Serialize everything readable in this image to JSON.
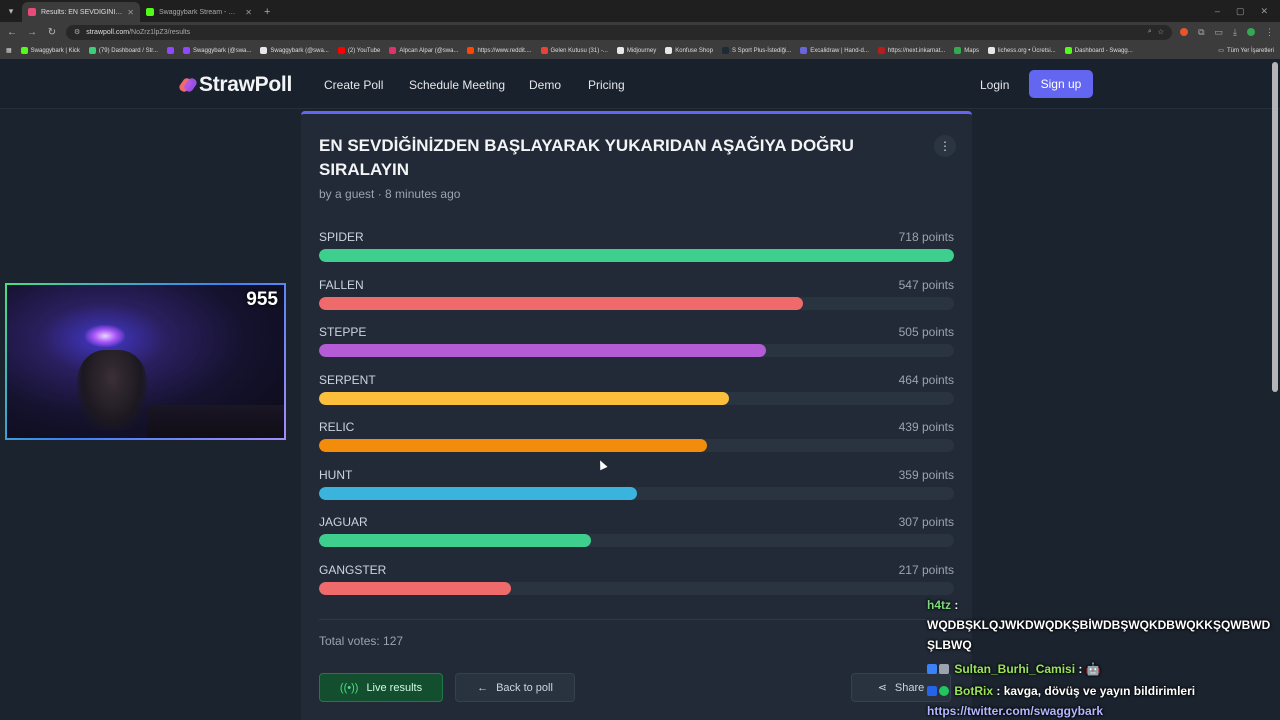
{
  "browser": {
    "tabs": [
      {
        "title": "Results: EN SEVDİĞİNİZDEN BAŞ",
        "color": "#e84a7a",
        "active": true
      },
      {
        "title": "Swaggybark Stream - Watch Li",
        "color": "#53fc18",
        "active": false
      }
    ],
    "url_host": "strawpoll.com",
    "url_path": "/NoZrz1lpZ3/results",
    "bookmarks": [
      {
        "label": "Swaggybark | Kick",
        "color": "#53fc18"
      },
      {
        "label": "(79) Dashboard / Str...",
        "color": "#3ccf7a"
      },
      {
        "label": "",
        "color": "#9146ff"
      },
      {
        "label": "Swaggybark (@swa...",
        "color": "#9146ff"
      },
      {
        "label": "Swaggybark (@swa...",
        "color": "#e5e7eb"
      },
      {
        "label": "(2) YouTube",
        "color": "#ff0000"
      },
      {
        "label": "Alpcan Alpar (@swa...",
        "color": "#e1306c"
      },
      {
        "label": "https://www.reddit....",
        "color": "#ff4500"
      },
      {
        "label": "Gelen Kutusu (31) -...",
        "color": "#ea4335"
      },
      {
        "label": "Midjourney",
        "color": "#e5e7eb"
      },
      {
        "label": "Konfuse Shop",
        "color": "#e5e7eb"
      },
      {
        "label": "S Sport Plus-İstediği...",
        "color": "#1f2937"
      },
      {
        "label": "Excalidraw | Hand-d...",
        "color": "#6965db"
      },
      {
        "label": "https://next.inkarnat...",
        "color": "#b91c1c"
      },
      {
        "label": "Maps",
        "color": "#34a853"
      },
      {
        "label": "lichess.org • Ücretsi...",
        "color": "#e5e7eb"
      },
      {
        "label": "Dashboard - Swagg...",
        "color": "#53fc18"
      }
    ],
    "all_bookmarks_label": "Tüm Yer İşaretleri"
  },
  "header": {
    "logo_text": "StrawPoll",
    "nav": [
      "Create Poll",
      "Schedule Meeting",
      "Demo",
      "Pricing"
    ],
    "login": "Login",
    "signup": "Sign up"
  },
  "poll": {
    "title": "EN SEVDİĞİNİZDEN BAŞLAYARAK YUKARIDAN AŞAĞIYA DOĞRU SIRALAYIN",
    "byline": "by a guest · 8 minutes ago",
    "max_points": 718,
    "options": [
      {
        "name": "SPIDER",
        "points_label": "718 points",
        "points": 718,
        "color": "#3ecf8e"
      },
      {
        "name": "FALLEN",
        "points_label": "547 points",
        "points": 547,
        "color": "#ef6b6b"
      },
      {
        "name": "STEPPE",
        "points_label": "505 points",
        "points": 505,
        "color": "#b45bd6"
      },
      {
        "name": "SERPENT",
        "points_label": "464 points",
        "points": 464,
        "color": "#fbbf3c"
      },
      {
        "name": "RELIC",
        "points_label": "439 points",
        "points": 439,
        "color": "#f28c0a"
      },
      {
        "name": "HUNT",
        "points_label": "359 points",
        "points": 359,
        "color": "#3bb4dd"
      },
      {
        "name": "JAGUAR",
        "points_label": "307 points",
        "points": 307,
        "color": "#3ecf8e"
      },
      {
        "name": "GANGSTER",
        "points_label": "217 points",
        "points": 217,
        "color": "#ef6b6b"
      }
    ],
    "total_votes": "Total votes: 127",
    "live_results": "Live results",
    "back_to_poll": "Back to poll",
    "share": "Share"
  },
  "overlay": {
    "viewer_count": "955",
    "chat": {
      "m1_user": "h4tz",
      "m1_text": "WQDBŞKLQJWKDWQDKŞBİWDBŞWQKDBWQKKŞQWBWDŞLBWQ",
      "m2_user": "Sultan_Burhi_Camisi",
      "m2_emote": "🤖",
      "m3_user": "BotRix",
      "m3_text": "kavga, dövüş ve yayın bildirimleri",
      "m4_link": "https://twitter.com/swaggybark"
    }
  }
}
